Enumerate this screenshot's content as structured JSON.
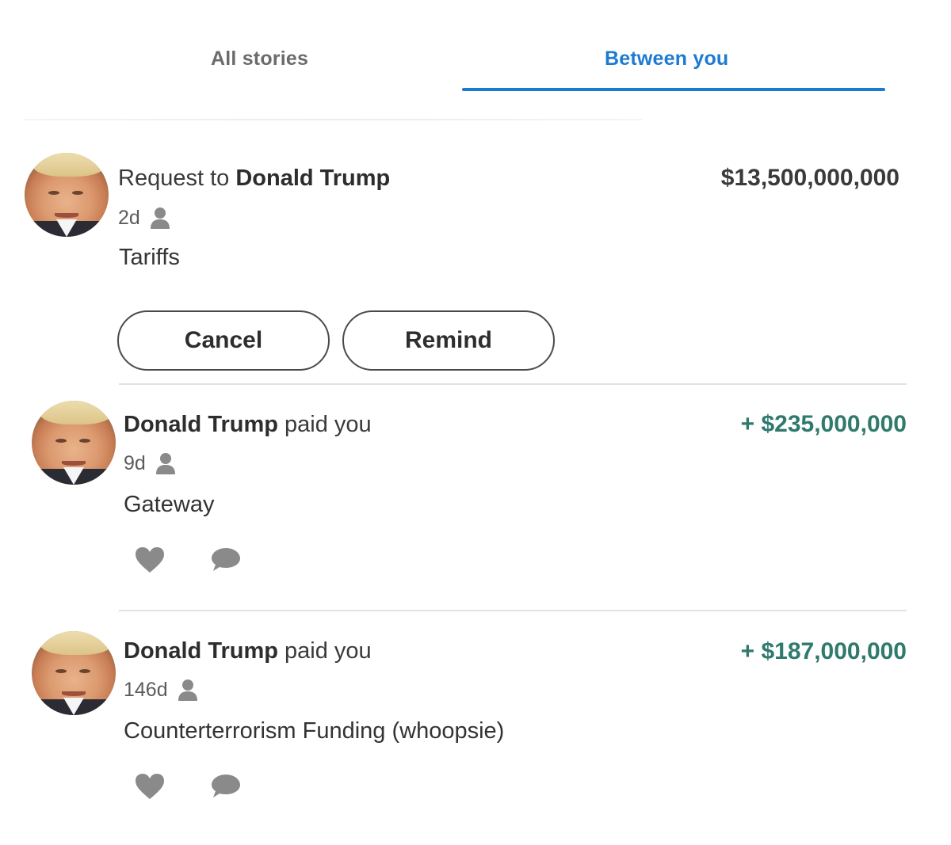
{
  "tabs": [
    {
      "label": "All stories",
      "active": false
    },
    {
      "label": "Between you",
      "active": true
    }
  ],
  "colors": {
    "accent": "#1c7ad1",
    "positive_amount": "#2f7a6d",
    "icon_gray": "#8a8a8a"
  },
  "items": [
    {
      "title_prefix": "Request to ",
      "title_name": "Donald Trump",
      "amount": "$13,500,000,000",
      "age": "2d",
      "visibility_icon": "person-icon",
      "note": "Tariffs",
      "actions": {
        "cancel": "Cancel",
        "remind": "Remind"
      }
    },
    {
      "title_name": "Donald Trump",
      "title_suffix": " paid you",
      "amount": "+ $235,000,000",
      "age": "9d",
      "visibility_icon": "person-icon",
      "note": "Gateway",
      "icons": [
        "heart-icon",
        "comment-icon"
      ]
    },
    {
      "title_name": "Donald Trump",
      "title_suffix": " paid you",
      "amount": "+ $187,000,000",
      "age": "146d",
      "visibility_icon": "person-icon",
      "note": "Counterterrorism Funding (whoopsie)",
      "icons": [
        "heart-icon",
        "comment-icon"
      ]
    }
  ]
}
